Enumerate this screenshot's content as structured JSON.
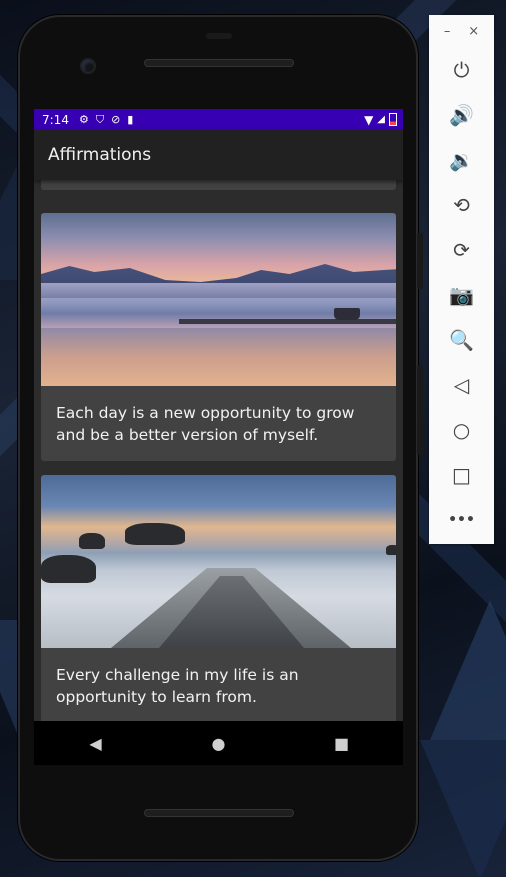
{
  "statusbar": {
    "time": "7:14",
    "left_icons": [
      "gear-icon",
      "shield-icon",
      "vpn-icon",
      "sd-card-icon"
    ],
    "right_icons": [
      "wifi-icon",
      "signal-icon",
      "battery-low-icon"
    ]
  },
  "appbar": {
    "title": "Affirmations"
  },
  "cards": [
    {
      "caption": "Each day is a new opportunity to grow and be a better version of myself.",
      "image": "lake-sunset-image"
    },
    {
      "caption": "Every challenge in my life is an opportunity to learn from.",
      "image": "ocean-pier-image"
    }
  ],
  "navbar": {
    "back": "◀",
    "home": "●",
    "recents": "■"
  },
  "emulator_panel": {
    "window_controls": {
      "minimize": "–",
      "close": "×"
    },
    "tools": [
      {
        "name": "power-icon",
        "glyph": "⏻"
      },
      {
        "name": "volume-up-icon",
        "glyph": "🔊"
      },
      {
        "name": "volume-down-icon",
        "glyph": "🔉"
      },
      {
        "name": "rotate-left-icon",
        "glyph": "⟲"
      },
      {
        "name": "rotate-right-icon",
        "glyph": "⟳"
      },
      {
        "name": "camera-icon",
        "glyph": "📷"
      },
      {
        "name": "zoom-icon",
        "glyph": "🔍"
      },
      {
        "name": "back-icon",
        "glyph": "◁"
      },
      {
        "name": "home-icon",
        "glyph": "○"
      },
      {
        "name": "overview-icon",
        "glyph": "□"
      },
      {
        "name": "more-icon",
        "glyph": "•••"
      }
    ]
  }
}
